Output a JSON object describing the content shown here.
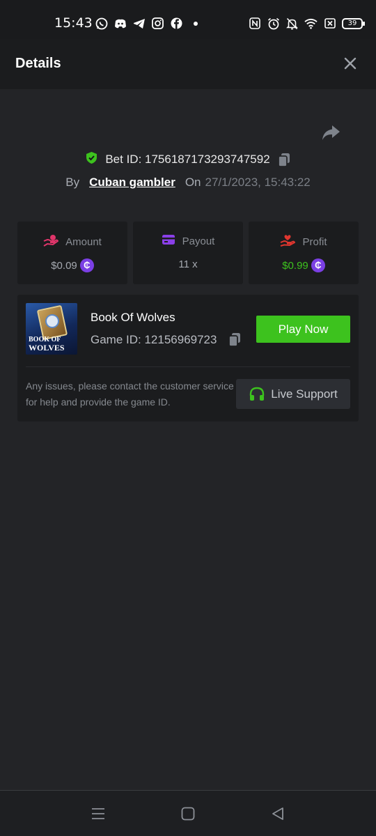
{
  "status_bar": {
    "time": "15:43",
    "battery": "39",
    "left_icons": [
      "whatsapp-icon",
      "discord-icon",
      "telegram-icon",
      "instagram-icon",
      "facebook-icon",
      "dot-icon"
    ],
    "right_icons": [
      "nfc-icon",
      "alarm-icon",
      "mute-icon",
      "wifi-icon",
      "close-box-icon"
    ]
  },
  "header": {
    "title": "Details",
    "close_icon": "close-icon"
  },
  "bet": {
    "bet_id_label": "Bet ID: 1756187173293747592",
    "by_label": "By",
    "username": "Cuban gambler",
    "on_label": "On",
    "datetime": "27/1/2023, 15:43:22"
  },
  "stats": {
    "amount": {
      "label": "Amount",
      "value": "$0.09",
      "icon": "hand-coins-icon",
      "color": "#e0356a"
    },
    "payout": {
      "label": "Payout",
      "value": "11 x",
      "icon": "card-icon",
      "color": "#8a3fe8"
    },
    "profit": {
      "label": "Profit",
      "value": "$0.99",
      "icon": "hand-heart-icon",
      "color": "#e0362f",
      "value_color": "#3dc21e"
    },
    "coin_symbol": "₵"
  },
  "game": {
    "thumb_title_line1": "BOOK OF",
    "thumb_title_line2": "WOLVES",
    "name": "Book Of Wolves",
    "game_id_label": "Game ID: 12156969723",
    "play_label": "Play Now",
    "issue_text": "Any issues, please contact the customer service for help and provide the game ID.",
    "support_label": "Live Support"
  },
  "colors": {
    "background": "#232427",
    "panel": "#1b1c1e",
    "accent_green": "#3dc21e",
    "coin_purple": "#7b3fe4"
  }
}
